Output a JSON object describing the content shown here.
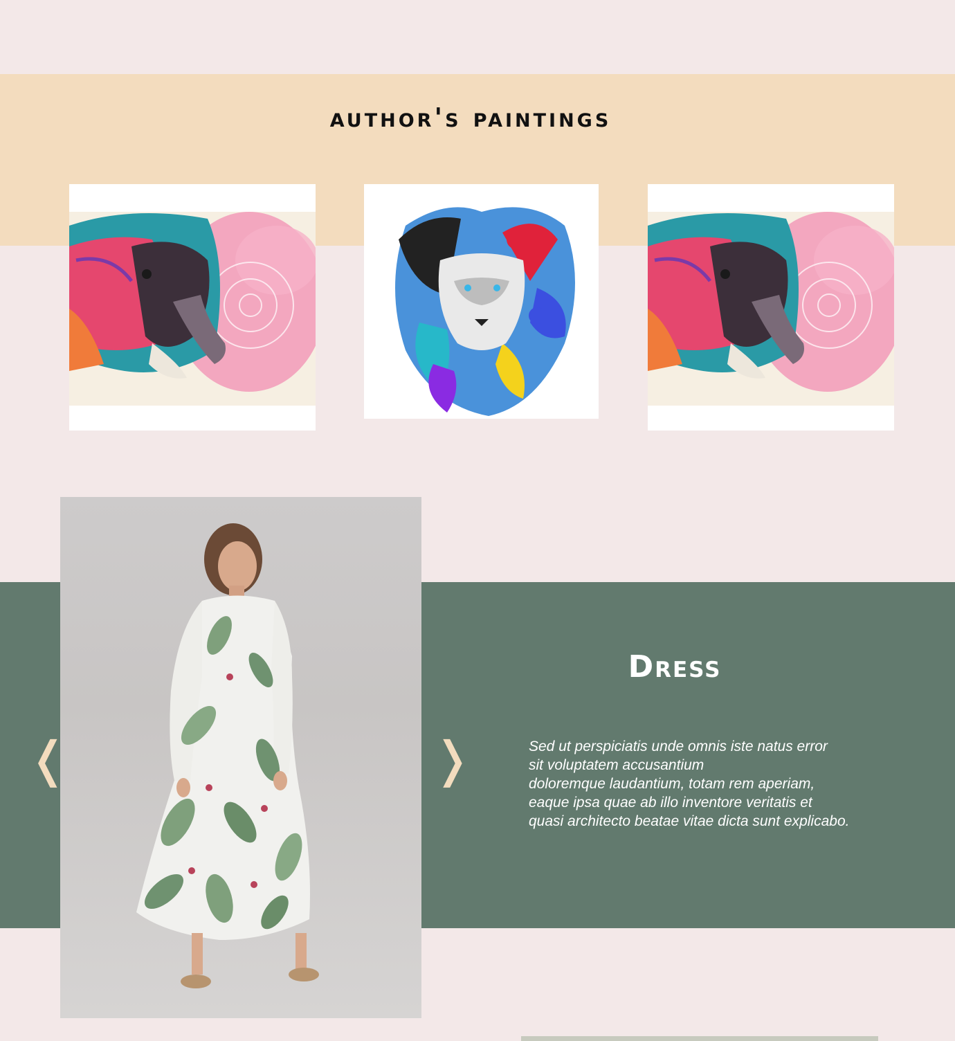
{
  "paintings": {
    "title": "author's paintings",
    "items": [
      {
        "name": "elephant-painting"
      },
      {
        "name": "lion-painting"
      },
      {
        "name": "elephant-painting"
      }
    ]
  },
  "dress": {
    "title": "Dress",
    "prev_icon": "chevron-left-icon",
    "next_icon": "chevron-right-icon",
    "prev_glyph": "❬",
    "next_glyph": "❭",
    "description_lines": [
      "Sed ut perspiciatis unde omnis iste natus error",
      "sit voluptatem accusantium",
      "doloremque laudantium, totam rem aperiam,",
      "eaque ipsa quae ab illo inventore veritatis et",
      "quasi architecto beatae vitae dicta sunt explicabo."
    ]
  },
  "colors": {
    "background": "#f3e8e8",
    "peach_band": "#f3dcbe",
    "green_band": "#627a6e",
    "accent": "#f3dcbe"
  }
}
